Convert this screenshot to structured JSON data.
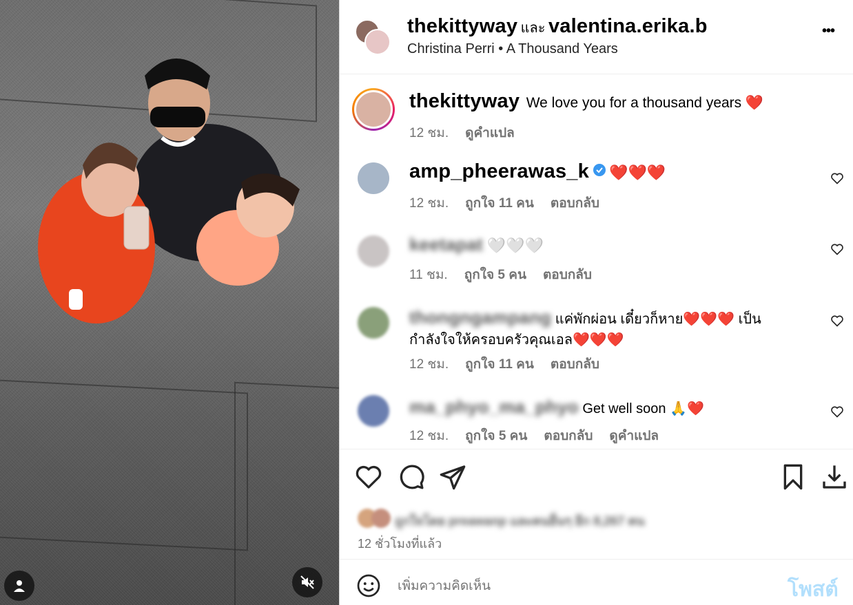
{
  "header": {
    "user1": "thekittyway",
    "joiner": "และ",
    "user2": "valentina.erika.b",
    "music_artist": "Christina Perri",
    "music_sep": "•",
    "music_title": "A Thousand Years",
    "more_label": "•••"
  },
  "caption": {
    "username": "thekittyway",
    "text": "We love you for a thousand years",
    "emoji": "❤️",
    "time": "12 ชม.",
    "translate": "ดูคำแปล"
  },
  "comments": [
    {
      "username": "amp_pheerawas_k",
      "verified": true,
      "text": "❤️❤️❤️",
      "time": "12 ชม.",
      "likes": "ถูกใจ 11 คน",
      "reply": "ตอบกลับ",
      "blurred": false
    },
    {
      "username": "keetapat",
      "text": "🤍🤍🤍",
      "time": "11 ชม.",
      "likes": "ถูกใจ 5 คน",
      "reply": "ตอบกลับ",
      "blurred": true
    },
    {
      "username": "thongngampang",
      "text_line1": "แค่พักผ่อน เดี๋ยวก็หาย❤️❤️❤️ เป็น",
      "text_line2": "กำลังใจให้ครอบครัวคุณเอล❤️❤️❤️",
      "time": "12 ชม.",
      "likes": "ถูกใจ 11 คน",
      "reply": "ตอบกลับ",
      "blurred": true
    },
    {
      "username": "ma_phyo_ma_phyo",
      "text": "Get well soon 🙏❤️",
      "time": "12 ชม.",
      "likes": "ถูกใจ 5 คน",
      "reply": "ตอบกลับ",
      "translate": "ดูคำแปล",
      "blurred": true
    }
  ],
  "likes_summary": {
    "text": "ถูกใจโดย preawanp และคนอื่นๆ อีก 8,267 คน",
    "time_ago": "12 ชั่วโมงที่แล้ว"
  },
  "footer": {
    "placeholder": "เพิ่มความคิดเห็น",
    "post_label": "โพสต์"
  },
  "colors": {
    "verified": "#3897f0",
    "post_disabled": "#b2dffc",
    "heart": "#ed1c24",
    "muted": "#737373"
  },
  "icons": [
    "person-icon",
    "mute-icon",
    "heart-icon",
    "comment-icon",
    "share-icon",
    "bookmark-icon",
    "download-icon",
    "emoji-icon",
    "more-icon",
    "verified-icon"
  ]
}
